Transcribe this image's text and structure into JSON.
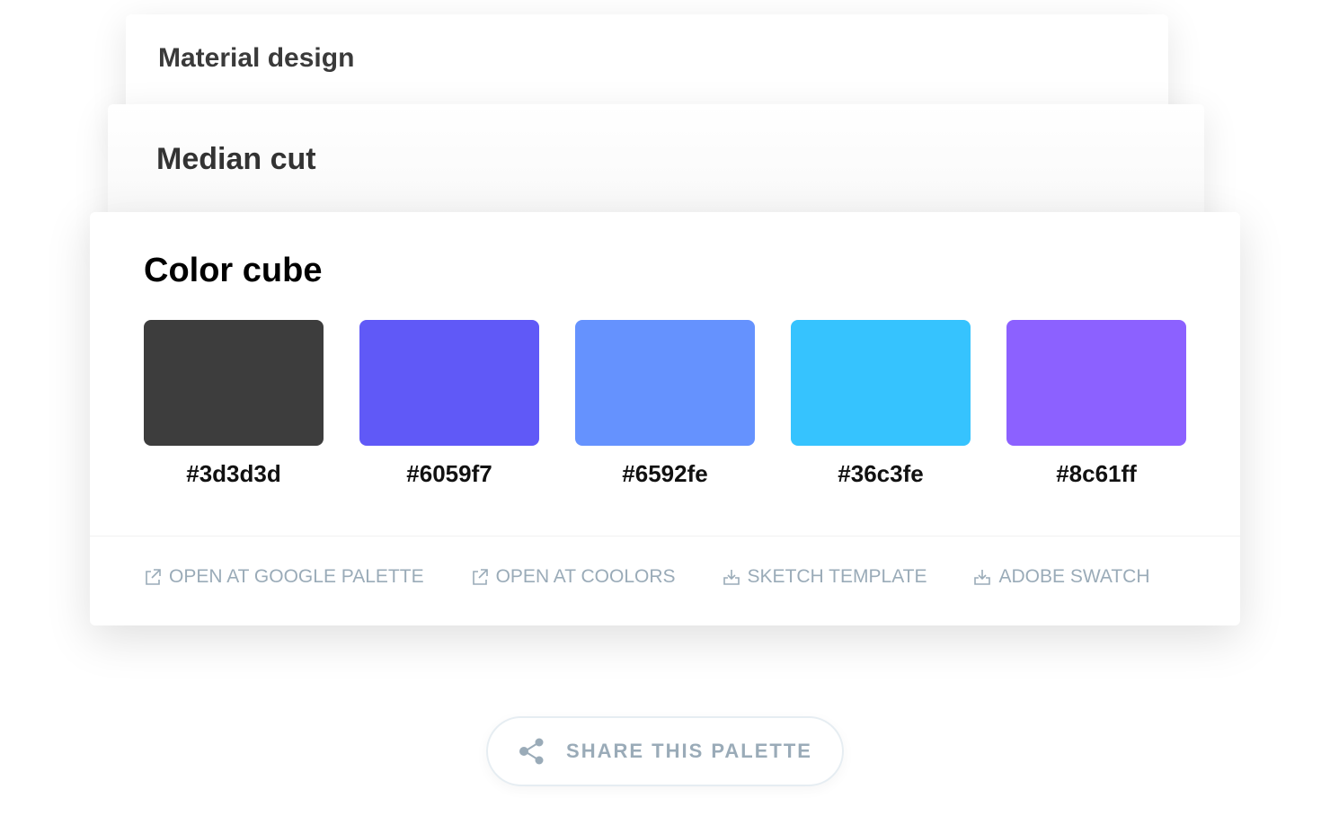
{
  "cards": {
    "material": "Material design",
    "median": "Median cut",
    "cube": "Color cube"
  },
  "swatches": [
    {
      "hex": "#3d3d3d"
    },
    {
      "hex": "#6059f7"
    },
    {
      "hex": "#6592fe"
    },
    {
      "hex": "#36c3fe"
    },
    {
      "hex": "#8c61ff"
    }
  ],
  "actions": [
    {
      "label": "OPEN AT GOOGLE PALETTE",
      "icon": "external-link-icon"
    },
    {
      "label": "OPEN AT COOLORS",
      "icon": "external-link-icon"
    },
    {
      "label": "SKETCH TEMPLATE",
      "icon": "download-icon"
    },
    {
      "label": "ADOBE SWATCH",
      "icon": "download-icon"
    }
  ],
  "share": {
    "label": "SHARE THIS PALETTE",
    "icon": "share-icon"
  },
  "colors": {
    "muted": "#9aabb8"
  }
}
